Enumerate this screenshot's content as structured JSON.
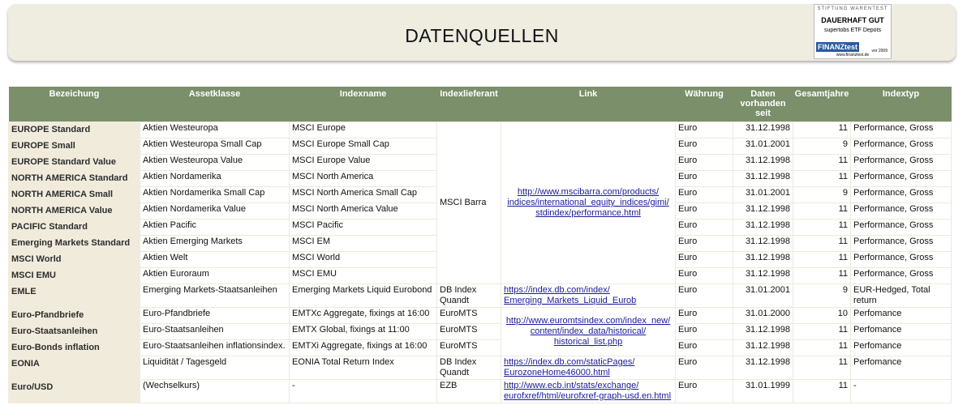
{
  "title": "DATENQUELLEN",
  "badge": {
    "org": "STIFTUNG WARENTEST",
    "rating": "DAUERHAFT GUT",
    "subject": "supertobs ETF Depots",
    "brand": "FINANZtest",
    "year": "vor 2009",
    "url": "www.finanztest.de"
  },
  "headers": [
    "Bezeichung",
    "Assetklasse",
    "Indexname",
    "Indexlieferant",
    "Link",
    "Währung",
    "Daten vorhanden seit",
    "Gesamtjahre",
    "Indextyp"
  ],
  "rows": [
    {
      "name": "EUROPE Standard",
      "asset": "Aktien Westeuropa",
      "index": "MSCI Europe",
      "currency": "Euro",
      "since": "31.12.1998",
      "years": "11",
      "type": "Performance, Gross"
    },
    {
      "name": "EUROPE Small",
      "asset": "Aktien Westeuropa Small Cap",
      "index": "MSCI Europe Small Cap",
      "currency": "Euro",
      "since": "31.01.2001",
      "years": "9",
      "type": "Performance, Gross"
    },
    {
      "name": "EUROPE Standard Value",
      "asset": "Aktien Westeuropa Value",
      "index": "MSCI Europe Value",
      "currency": "Euro",
      "since": "31.12.1998",
      "years": "11",
      "type": "Performance, Gross"
    },
    {
      "name": "NORTH AMERICA Standard",
      "asset": "Aktien Nordamerika",
      "index": "MSCI North America",
      "currency": "Euro",
      "since": "31.12.1998",
      "years": "11",
      "type": "Performance, Gross"
    },
    {
      "name": "NORTH AMERICA Small",
      "asset": "Aktien Nordamerika Small Cap",
      "index": "MSCI North America Small Cap",
      "currency": "Euro",
      "since": "31.01.2001",
      "years": "9",
      "type": "Performance, Gross"
    },
    {
      "name": "NORTH AMERICA Value",
      "asset": "Aktien Nordamerika Value",
      "index": "MSCI North America Value",
      "currency": "Euro",
      "since": "31.12.1998",
      "years": "11",
      "type": "Performance, Gross"
    },
    {
      "name": "PACIFIC Standard",
      "asset": "Aktien Pacific",
      "index": "MSCI Pacific",
      "currency": "Euro",
      "since": "31.12.1998",
      "years": "11",
      "type": "Performance, Gross"
    },
    {
      "name": "Emerging Markets Standard",
      "asset": "Aktien Emerging Markets",
      "index": "MSCI EM",
      "currency": "Euro",
      "since": "31.12.1998",
      "years": "11",
      "type": "Performance, Gross"
    },
    {
      "name": "MSCI World",
      "asset": "Aktien Welt",
      "index": "MSCI World",
      "currency": "Euro",
      "since": "31.12.1998",
      "years": "11",
      "type": "Performance, Gross"
    },
    {
      "name": "MSCI EMU",
      "asset": "Aktien Euroraum",
      "index": "MSCI EMU",
      "currency": "Euro",
      "since": "31.12.1998",
      "years": "11",
      "type": "Performance, Gross"
    },
    {
      "name": "EMLE",
      "asset": "Emerging Markets-Staatsanleihen",
      "index": "Emerging Markets Liquid Eurobond",
      "provider": "DB Index Quandt",
      "link": "https://index.db.com/index/ Emerging_Markets_Liquid_Eurob",
      "currency": "Euro",
      "since": "31.01.2001",
      "years": "9",
      "type": "EUR-Hedged, Total return"
    },
    {
      "name": "Euro-Pfandbriefe",
      "asset": "Euro-Pfandbriefe",
      "index": "EMTXc Aggregate, fixings at 16:00",
      "provider": "EuroMTS",
      "currency": "Euro",
      "since": "31.01.2000",
      "years": "10",
      "type": "Perfomance"
    },
    {
      "name": "Euro-Staatsanleihen",
      "asset": "Euro-Staatsanleihen",
      "index": "EMTX Global, fixings at 11:00",
      "provider": "EuroMTS",
      "currency": "Euro",
      "since": "31.12.1998",
      "years": "11",
      "type": "Perfomance"
    },
    {
      "name": "Euro-Bonds inflation",
      "asset": "Euro-Staatsanleihen inflationsindex.",
      "index": "EMTXi Aggregate, fixings at 16:00",
      "provider": "EuroMTS",
      "currency": "Euro",
      "since": "31.12.1998",
      "years": "11",
      "type": "Perfomance"
    },
    {
      "name": "EONIA",
      "asset": "Liquidität / Tagesgeld",
      "index": "EONIA Total Return Index",
      "provider": "DB Index Quandt",
      "link": "https://index.db.com/staticPages/ EurozoneHome46000.html",
      "currency": "Euro",
      "since": "31.12.1998",
      "years": "11",
      "type": "Perfomance"
    },
    {
      "name": "Euro/USD",
      "asset": "(Wechselkurs)",
      "index": "-",
      "provider": "EZB",
      "link": "http://www.ecb.int/stats/exchange/ eurofxref/html/eurofxref-graph-usd.en.html",
      "currency": "Euro",
      "since": "31.01.1999",
      "years": "11",
      "type": "-"
    }
  ],
  "merged": {
    "msci_provider": "MSCI Barra",
    "msci_link": "http://www.mscibarra.com/products/ indices/international_equity_indices/gimi/ stdindex/performance.html",
    "eurmts_link": "http://www.euromtsindex.com/index_new/ content/index_data/historical/ historical_list.php"
  }
}
